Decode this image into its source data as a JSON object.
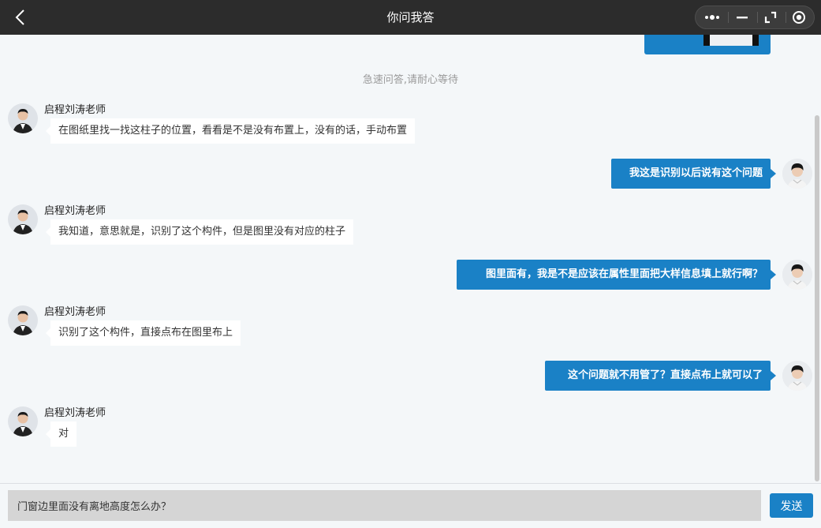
{
  "window": {
    "title": "你问我答"
  },
  "capsule": {
    "icons": [
      "more-icon",
      "minimize-icon",
      "restore-icon",
      "close-target-icon"
    ]
  },
  "chat": {
    "notice": "急速问答,请耐心等待",
    "messages": [
      {
        "direction": "in",
        "sender": "启程刘涛老师",
        "text": "在图纸里找一找这柱子的位置，看看是不是没有布置上，没有的话，手动布置"
      },
      {
        "direction": "out",
        "text": "我这是识别以后说有这个问题"
      },
      {
        "direction": "in",
        "sender": "启程刘涛老师",
        "text": "我知道，意思就是，识别了这个构件，但是图里没有对应的柱子"
      },
      {
        "direction": "out",
        "text": "图里面有，我是不是应该在属性里面把大样信息填上就行啊？"
      },
      {
        "direction": "in",
        "sender": "启程刘涛老师",
        "text": "识别了这个构件，直接点布在图里布上"
      },
      {
        "direction": "out",
        "text": "这个问题就不用管了？直接点布上就可以了"
      },
      {
        "direction": "in",
        "sender": "启程刘涛老师",
        "text": "对"
      }
    ]
  },
  "composer": {
    "value": "门窗边里面没有离地高度怎么办？",
    "send_label": "发送"
  },
  "colors": {
    "accent": "#1a81c6",
    "titlebar": "#2c2c2c",
    "background": "#f4f7f9"
  }
}
